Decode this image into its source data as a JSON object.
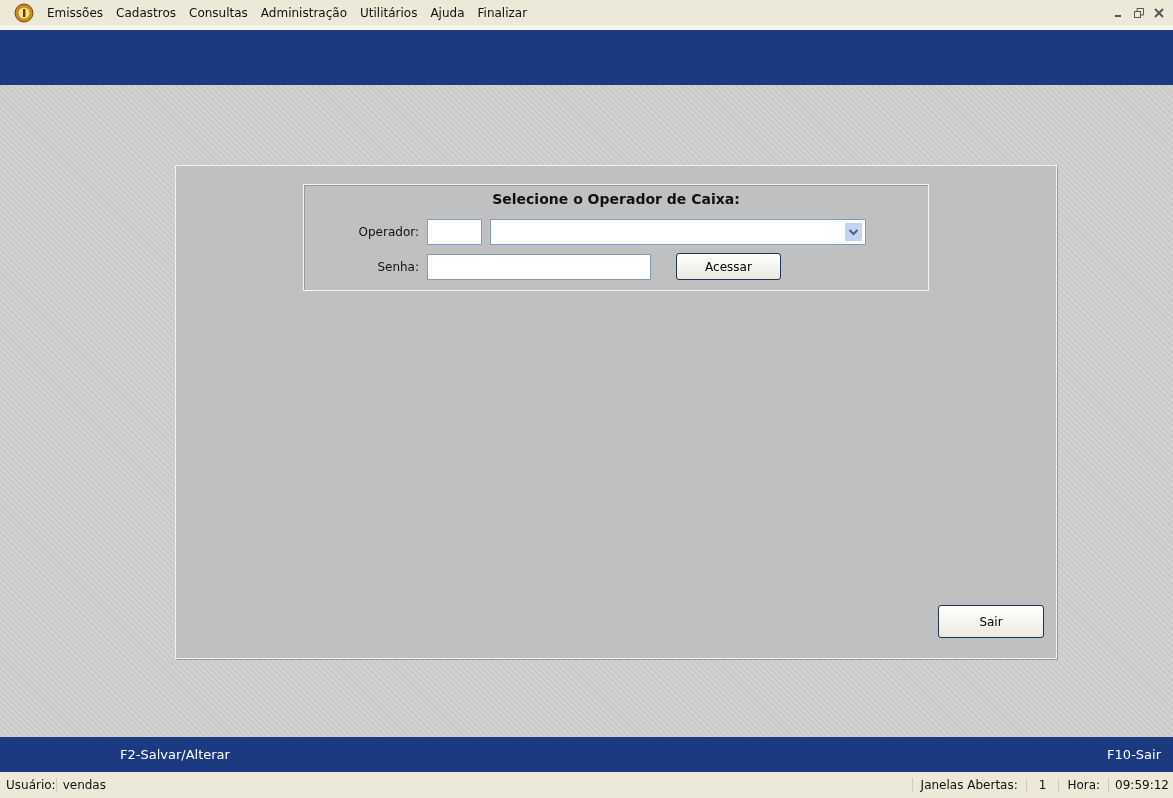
{
  "menu": [
    {
      "label": "Emissões"
    },
    {
      "label": "Cadastros"
    },
    {
      "label": "Consultas"
    },
    {
      "label": "Administração"
    },
    {
      "label": "Utilitários"
    },
    {
      "label": "Ajuda"
    },
    {
      "label": "Finalizar"
    }
  ],
  "form": {
    "title": "Selecione o Operador de Caixa:",
    "operator_label": "Operador:",
    "password_label": "Senha:",
    "access_button": "Acessar"
  },
  "exit_button": "Sair",
  "shortcut_bar": {
    "left": "F2-Salvar/Alterar",
    "right": "F10-Sair"
  },
  "status_bar": {
    "user_label": "Usuário:",
    "user": "vendas",
    "windows_label": "Janelas Abertas:",
    "windows": "1",
    "time_label": "Hora:",
    "time": "09:59:12"
  }
}
